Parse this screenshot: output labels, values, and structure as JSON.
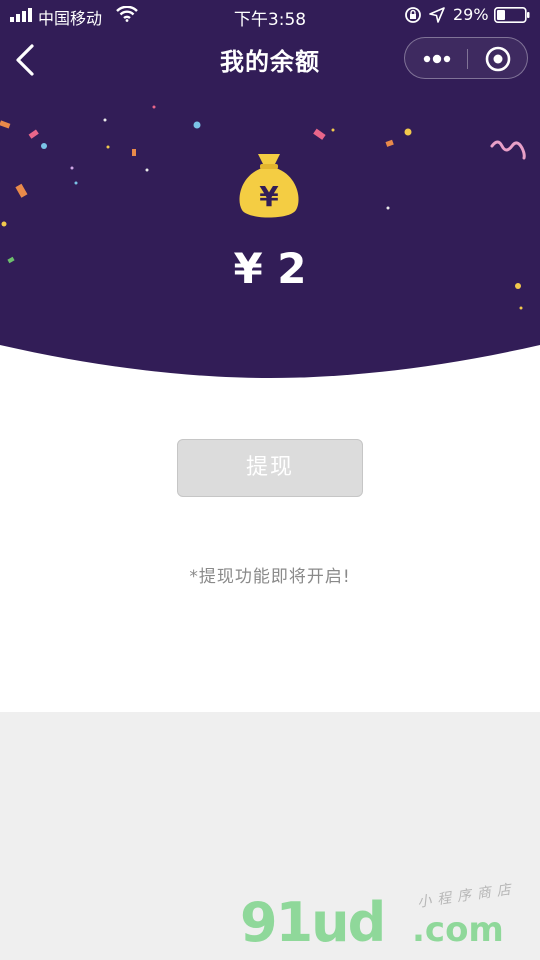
{
  "status_bar": {
    "carrier": "中国移动",
    "time": "下午3:58",
    "battery": "29%"
  },
  "nav": {
    "title": "我的余额",
    "back_icon": "chevron-left-icon",
    "more_icon": "more-dots-icon",
    "close_icon": "target-circle-icon"
  },
  "wallet": {
    "bag_icon": "money-bag-icon",
    "bag_symbol": "¥",
    "balance": "¥ 2"
  },
  "actions": {
    "withdraw_label": "提现"
  },
  "notice": "*提现功能即将开启!",
  "watermark": {
    "main": "91ud",
    "tld": ".com",
    "sub": "小程序商店"
  },
  "colors": {
    "hero_bg": "#321d57",
    "bag": "#f4cd43",
    "button_bg": "#dcdcdc",
    "notice_text": "#8a8a8a",
    "page_bg": "#efefef"
  }
}
